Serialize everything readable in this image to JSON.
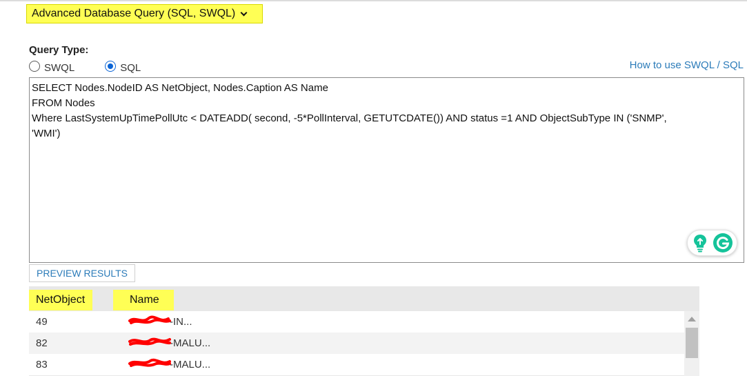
{
  "query_source": {
    "selected_label": "Advanced Database Query (SQL, SWQL)"
  },
  "query_type": {
    "label": "Query Type:",
    "options": [
      {
        "label": "SWQL",
        "checked": false
      },
      {
        "label": "SQL",
        "checked": true
      }
    ],
    "help_link": "How to use SWQL / SQL"
  },
  "query": {
    "lines": [
      "SELECT Nodes.NodeID AS NetObject, Nodes.Caption AS Name",
      "FROM Nodes",
      "Where LastSystemUpTimePollUtc < DATEADD( second, -5*PollInterval, GETUTCDATE()) AND status =1 AND ObjectSubType IN ('SNMP',",
      "'WMI')"
    ]
  },
  "preview_button": "PREVIEW RESULTS",
  "results": {
    "columns": [
      "NetObject",
      "Name"
    ],
    "rows": [
      {
        "netobject": "49",
        "name": "-IN..."
      },
      {
        "netobject": "82",
        "name": "-MALU..."
      },
      {
        "netobject": "83",
        "name": "-MALU..."
      }
    ]
  },
  "icons": {
    "dropdown": "chevron-down-icon",
    "assist_1": "lightbulb-icon",
    "assist_2": "grammarly-g-icon",
    "scroll": "scroll-up-arrow-icon",
    "redaction": "red-scribble-redaction"
  },
  "colors": {
    "highlight": "#ffff55",
    "link": "#2b7bb9",
    "radio_selected": "#0a64d6",
    "grammarly_green": "#15c39a",
    "redaction": "#ff0000"
  }
}
